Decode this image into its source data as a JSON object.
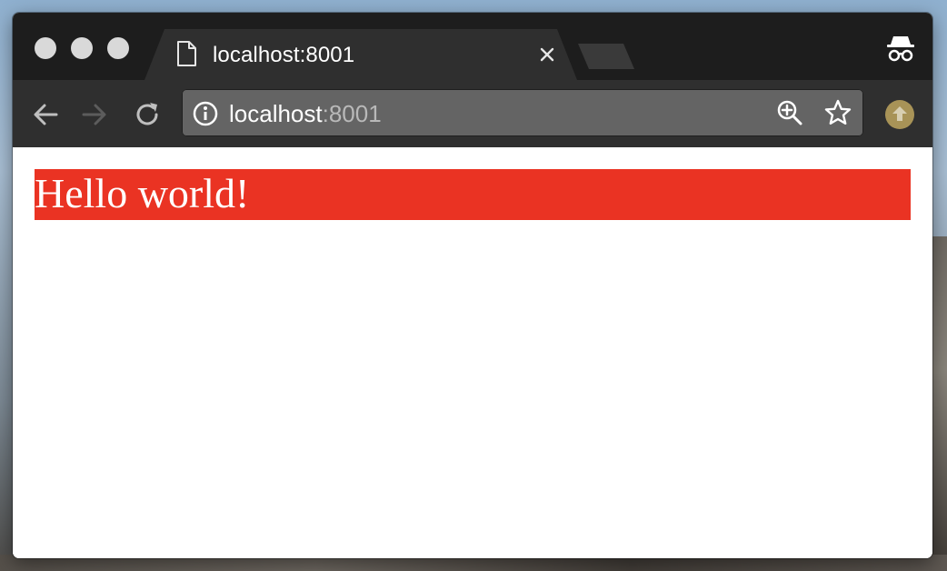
{
  "browser": {
    "tab": {
      "title": "localhost:8001",
      "page_icon": "document-icon",
      "close_icon": "close-icon"
    },
    "address_bar": {
      "host": "localhost",
      "port": ":8001",
      "info_icon": "info-icon",
      "zoom_icon": "zoom-in-icon",
      "bookmark_icon": "star-icon"
    },
    "nav": {
      "back_icon": "arrow-left-icon",
      "forward_icon": "arrow-right-icon",
      "reload_icon": "reload-icon"
    },
    "incognito_icon": "incognito-icon",
    "extension_icon": "extension-upload-icon"
  },
  "page": {
    "heading": "Hello world!",
    "heading_background": "#ea3323"
  },
  "colors": {
    "titlebar": "#1d1d1d",
    "toolbar": "#2f2f2f",
    "tab_active": "#2f2f2f",
    "omnibox": "#646464",
    "extension_badge": "#a89357"
  }
}
